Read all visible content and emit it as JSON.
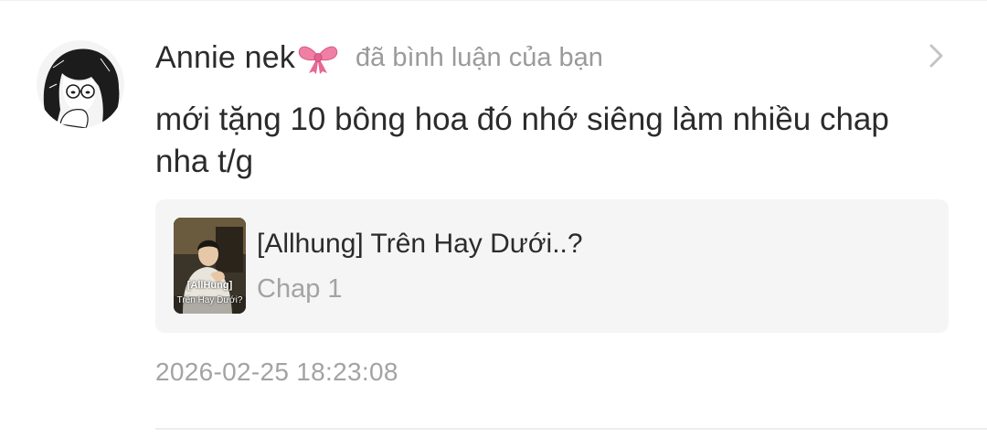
{
  "notification": {
    "username": "Annie nek",
    "username_emoji": "bow-emoji",
    "action": "đã bình luận của bạn",
    "comment": "mới tặng 10 bông hoa đó nhớ siêng làm nhiều chap nha t/g",
    "timestamp": "2026-02-25 18:23:08"
  },
  "manga_card": {
    "title": "[Allhung] Trên Hay Dưới..?",
    "chapter": "Chap 1",
    "cover_title": "[AllHung]",
    "cover_subtitle": "Trên Hay Dưới?"
  },
  "icons": {
    "avatar": "anime-girl-avatar",
    "bow": "pink-bow-emoji",
    "chevron": "chevron-right-icon"
  },
  "colors": {
    "primary_text": "#2b2b2b",
    "secondary_text": "#9a9a9a",
    "card_background": "#f5f5f5",
    "bow_pink": "#f07fa4"
  }
}
